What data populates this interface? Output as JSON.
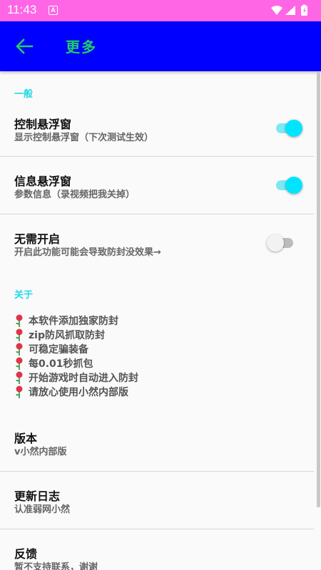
{
  "status_bar": {
    "time": "11:43",
    "notification_letter": "A",
    "bg_color": "#ff66e6"
  },
  "app_bar": {
    "title": "更多",
    "bg_color": "#0000ff",
    "title_color": "#22cc66",
    "back_icon": "arrow-left-icon"
  },
  "sections": {
    "general": "一般",
    "about": "关于"
  },
  "prefs": {
    "control_float": {
      "title": "控制悬浮窗",
      "summary": "显示控制悬浮窗（下次测试生效）",
      "enabled": true
    },
    "info_float": {
      "title": "信息悬浮窗",
      "summary": "参数信息（录视频把我关掉）",
      "enabled": true
    },
    "no_need_enable": {
      "title": "无需开启",
      "summary": "开启此功能可能会导致防封没效果→",
      "enabled": false
    }
  },
  "about_lines": [
    "本软件添加独家防封",
    "zip防风抓取防封",
    "可稳定骗装备",
    "每0.01秒抓包",
    "开始游戏时自动进入防封",
    "请放心使用小然内部版"
  ],
  "info": {
    "version": {
      "title": "版本",
      "summary": "v小然内部版"
    },
    "changelog": {
      "title": "更新日志",
      "summary": "认准弱网小然"
    },
    "feedback": {
      "title": "反馈",
      "summary": "暂不支持联系，谢谢"
    }
  },
  "accent_color": "#00e5ff"
}
